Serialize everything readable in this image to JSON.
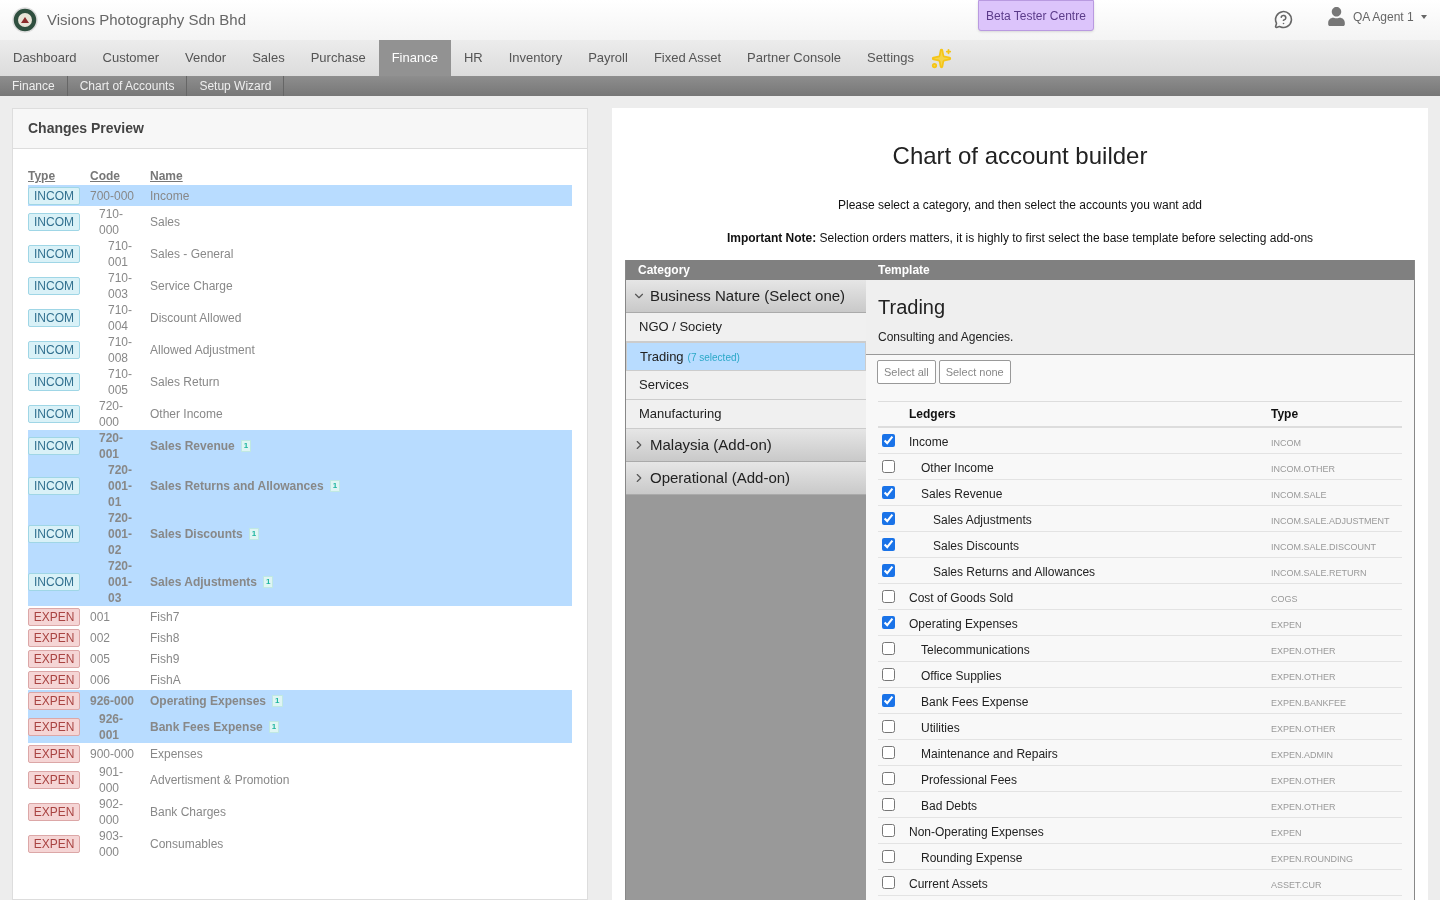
{
  "header": {
    "company": "Visions Photography Sdn Bhd",
    "beta_button": "Beta Tester Centre",
    "user": "QA Agent 1"
  },
  "nav": [
    {
      "label": "Dashboard",
      "selected": false
    },
    {
      "label": "Customer",
      "selected": false
    },
    {
      "label": "Vendor",
      "selected": false
    },
    {
      "label": "Sales",
      "selected": false
    },
    {
      "label": "Purchase",
      "selected": false
    },
    {
      "label": "Finance",
      "selected": true
    },
    {
      "label": "HR",
      "selected": false
    },
    {
      "label": "Inventory",
      "selected": false
    },
    {
      "label": "Payroll",
      "selected": false
    },
    {
      "label": "Fixed Asset",
      "selected": false
    },
    {
      "label": "Partner Console",
      "selected": false
    },
    {
      "label": "Settings",
      "selected": false
    }
  ],
  "breadcrumb": [
    "Finance",
    "Chart of Accounts",
    "Setup Wizard"
  ],
  "preview": {
    "title": "Changes Preview",
    "columns": [
      "Type",
      "Code",
      "Name"
    ],
    "rows": [
      {
        "type": "INCOM",
        "kind": "income",
        "code": "700-000",
        "name": "Income",
        "selected": true,
        "added": false,
        "children": [
          {
            "type": "INCOM",
            "kind": "income",
            "code": "710-000",
            "name": "Sales",
            "selected": false,
            "added": false,
            "children": [
              {
                "type": "INCOM",
                "kind": "income",
                "code": "710-001",
                "name": "Sales - General",
                "selected": false,
                "added": false
              },
              {
                "type": "INCOM",
                "kind": "income",
                "code": "710-003",
                "name": "Service Charge",
                "selected": false,
                "added": false
              },
              {
                "type": "INCOM",
                "kind": "income",
                "code": "710-004",
                "name": "Discount Allowed",
                "selected": false,
                "added": false
              },
              {
                "type": "INCOM",
                "kind": "income",
                "code": "710-008",
                "name": "Allowed Adjustment",
                "selected": false,
                "added": false
              },
              {
                "type": "INCOM",
                "kind": "income",
                "code": "710-005",
                "name": "Sales Return",
                "selected": false,
                "added": false
              }
            ]
          },
          {
            "type": "INCOM",
            "kind": "income",
            "code": "720-000",
            "name": "Other Income",
            "selected": false,
            "added": false
          },
          {
            "type": "INCOM",
            "kind": "income",
            "code": "720-001",
            "name": "Sales Revenue",
            "selected": true,
            "added": true,
            "badge": "1",
            "children": [
              {
                "type": "INCOM",
                "kind": "income",
                "code": "720-001-01",
                "name": "Sales Returns and Allowances",
                "selected": true,
                "added": true,
                "badge": "1"
              },
              {
                "type": "INCOM",
                "kind": "income",
                "code": "720-001-02",
                "name": "Sales Discounts",
                "selected": true,
                "added": true,
                "badge": "1"
              },
              {
                "type": "INCOM",
                "kind": "income",
                "code": "720-001-03",
                "name": "Sales Adjustments",
                "selected": true,
                "added": true,
                "badge": "1"
              }
            ]
          }
        ]
      },
      {
        "type": "EXPEN",
        "kind": "expense",
        "code": "001",
        "name": "Fish7",
        "selected": false,
        "added": false
      },
      {
        "type": "EXPEN",
        "kind": "expense",
        "code": "002",
        "name": "Fish8",
        "selected": false,
        "added": false
      },
      {
        "type": "EXPEN",
        "kind": "expense",
        "code": "005",
        "name": "Fish9",
        "selected": false,
        "added": false
      },
      {
        "type": "EXPEN",
        "kind": "expense",
        "code": "006",
        "name": "FishA",
        "selected": false,
        "added": false
      },
      {
        "type": "EXPEN",
        "kind": "expense",
        "code": "926-000",
        "name": "Operating Expenses",
        "selected": true,
        "added": true,
        "badge": "1",
        "children": [
          {
            "type": "EXPEN",
            "kind": "expense",
            "code": "926-001",
            "name": "Bank Fees Expense",
            "selected": true,
            "added": true,
            "badge": "1"
          }
        ]
      },
      {
        "type": "EXPEN",
        "kind": "expense",
        "code": "900-000",
        "name": "Expenses",
        "selected": false,
        "added": false,
        "children": [
          {
            "type": "EXPEN",
            "kind": "expense",
            "code": "901-000",
            "name": "Advertisment & Promotion",
            "selected": false,
            "added": false
          },
          {
            "type": "EXPEN",
            "kind": "expense",
            "code": "902-000",
            "name": "Bank Charges",
            "selected": false,
            "added": false
          },
          {
            "type": "EXPEN",
            "kind": "expense",
            "code": "903-000",
            "name": "Consumables",
            "selected": false,
            "added": false
          }
        ]
      }
    ]
  },
  "builder": {
    "title": "Chart of account builder",
    "instruction": "Please select a category, and then select the accounts you want add",
    "note": "**Important Note:** Selection orders matters, it is highly to first select the base template before selecting add-ons",
    "category_header": "Category",
    "template_header": "Template",
    "groups": [
      {
        "label": "Business Nature (Select one)",
        "expanded": true,
        "items": [
          {
            "label": "NGO / Society",
            "selected": false
          },
          {
            "label": "Trading",
            "count": "(7 selected)",
            "selected": true
          },
          {
            "label": "Services",
            "selected": false
          },
          {
            "label": "Manufacturing",
            "selected": false
          }
        ]
      },
      {
        "label": "Malaysia (Add-on)",
        "expanded": false
      },
      {
        "label": "Operational (Add-on)",
        "expanded": false
      }
    ],
    "template": {
      "title": "Trading",
      "description": "Consulting and Agencies.",
      "buttons": [
        "Select all",
        "Select none"
      ],
      "columns": [
        "Ledgers",
        "Type"
      ],
      "ledgers": [
        {
          "name": "Income",
          "type": "INCOM",
          "checked": true,
          "children": [
            {
              "name": "Other Income",
              "type": "INCOM.OTHER",
              "checked": false
            },
            {
              "name": "Sales Revenue",
              "type": "INCOM.SALE",
              "checked": true,
              "children": [
                {
                  "name": "Sales Adjustments",
                  "type": "INCOM.SALE.ADJUSTMENT",
                  "checked": true
                },
                {
                  "name": "Sales Discounts",
                  "type": "INCOM.SALE.DISCOUNT",
                  "checked": true
                },
                {
                  "name": "Sales Returns and Allowances",
                  "type": "INCOM.SALE.RETURN",
                  "checked": true
                }
              ]
            }
          ]
        },
        {
          "name": "Cost of Goods Sold",
          "type": "COGS",
          "checked": false
        },
        {
          "name": "Operating Expenses",
          "type": "EXPEN",
          "checked": true,
          "children": [
            {
              "name": "Telecommunications",
              "type": "EXPEN.OTHER",
              "checked": false
            },
            {
              "name": "Office Supplies",
              "type": "EXPEN.OTHER",
              "checked": false
            },
            {
              "name": "Bank Fees Expense",
              "type": "EXPEN.BANKFEE",
              "checked": true
            },
            {
              "name": "Utilities",
              "type": "EXPEN.OTHER",
              "checked": false
            },
            {
              "name": "Maintenance and Repairs",
              "type": "EXPEN.ADMIN",
              "checked": false
            },
            {
              "name": "Professional Fees",
              "type": "EXPEN.OTHER",
              "checked": false
            },
            {
              "name": "Bad Debts",
              "type": "EXPEN.OTHER",
              "checked": false
            }
          ]
        },
        {
          "name": "Non-Operating Expenses",
          "type": "EXPEN",
          "checked": false,
          "children": [
            {
              "name": "Rounding Expense",
              "type": "EXPEN.ROUNDING",
              "checked": false
            }
          ]
        },
        {
          "name": "Current Assets",
          "type": "ASSET.CUR",
          "checked": false
        }
      ]
    }
  }
}
